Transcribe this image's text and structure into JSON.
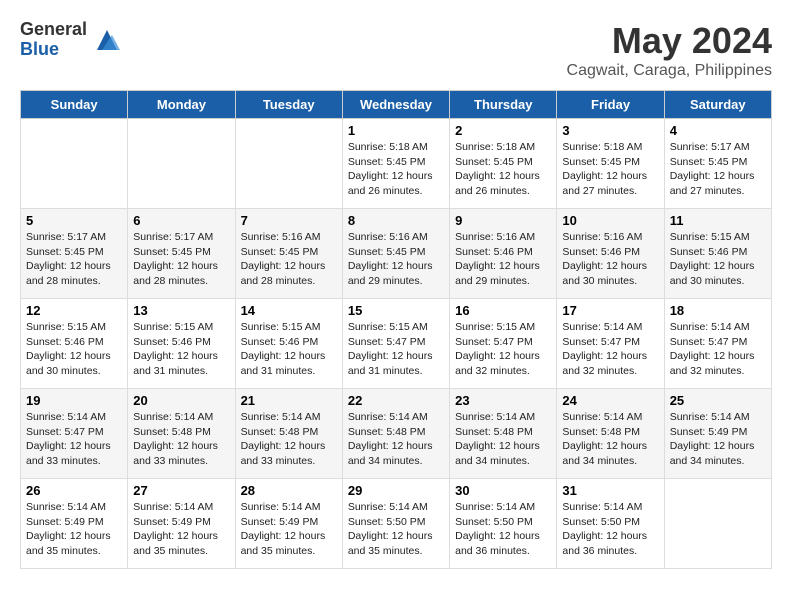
{
  "logo": {
    "general": "General",
    "blue": "Blue"
  },
  "title": "May 2024",
  "subtitle": "Cagwait, Caraga, Philippines",
  "days": [
    "Sunday",
    "Monday",
    "Tuesday",
    "Wednesday",
    "Thursday",
    "Friday",
    "Saturday"
  ],
  "weeks": [
    [
      {
        "date": "",
        "content": ""
      },
      {
        "date": "",
        "content": ""
      },
      {
        "date": "",
        "content": ""
      },
      {
        "date": "1",
        "content": "Sunrise: 5:18 AM\nSunset: 5:45 PM\nDaylight: 12 hours and 26 minutes."
      },
      {
        "date": "2",
        "content": "Sunrise: 5:18 AM\nSunset: 5:45 PM\nDaylight: 12 hours and 26 minutes."
      },
      {
        "date": "3",
        "content": "Sunrise: 5:18 AM\nSunset: 5:45 PM\nDaylight: 12 hours and 27 minutes."
      },
      {
        "date": "4",
        "content": "Sunrise: 5:17 AM\nSunset: 5:45 PM\nDaylight: 12 hours and 27 minutes."
      }
    ],
    [
      {
        "date": "5",
        "content": "Sunrise: 5:17 AM\nSunset: 5:45 PM\nDaylight: 12 hours and 28 minutes."
      },
      {
        "date": "6",
        "content": "Sunrise: 5:17 AM\nSunset: 5:45 PM\nDaylight: 12 hours and 28 minutes."
      },
      {
        "date": "7",
        "content": "Sunrise: 5:16 AM\nSunset: 5:45 PM\nDaylight: 12 hours and 28 minutes."
      },
      {
        "date": "8",
        "content": "Sunrise: 5:16 AM\nSunset: 5:45 PM\nDaylight: 12 hours and 29 minutes."
      },
      {
        "date": "9",
        "content": "Sunrise: 5:16 AM\nSunset: 5:46 PM\nDaylight: 12 hours and 29 minutes."
      },
      {
        "date": "10",
        "content": "Sunrise: 5:16 AM\nSunset: 5:46 PM\nDaylight: 12 hours and 30 minutes."
      },
      {
        "date": "11",
        "content": "Sunrise: 5:15 AM\nSunset: 5:46 PM\nDaylight: 12 hours and 30 minutes."
      }
    ],
    [
      {
        "date": "12",
        "content": "Sunrise: 5:15 AM\nSunset: 5:46 PM\nDaylight: 12 hours and 30 minutes."
      },
      {
        "date": "13",
        "content": "Sunrise: 5:15 AM\nSunset: 5:46 PM\nDaylight: 12 hours and 31 minutes."
      },
      {
        "date": "14",
        "content": "Sunrise: 5:15 AM\nSunset: 5:46 PM\nDaylight: 12 hours and 31 minutes."
      },
      {
        "date": "15",
        "content": "Sunrise: 5:15 AM\nSunset: 5:47 PM\nDaylight: 12 hours and 31 minutes."
      },
      {
        "date": "16",
        "content": "Sunrise: 5:15 AM\nSunset: 5:47 PM\nDaylight: 12 hours and 32 minutes."
      },
      {
        "date": "17",
        "content": "Sunrise: 5:14 AM\nSunset: 5:47 PM\nDaylight: 12 hours and 32 minutes."
      },
      {
        "date": "18",
        "content": "Sunrise: 5:14 AM\nSunset: 5:47 PM\nDaylight: 12 hours and 32 minutes."
      }
    ],
    [
      {
        "date": "19",
        "content": "Sunrise: 5:14 AM\nSunset: 5:47 PM\nDaylight: 12 hours and 33 minutes."
      },
      {
        "date": "20",
        "content": "Sunrise: 5:14 AM\nSunset: 5:48 PM\nDaylight: 12 hours and 33 minutes."
      },
      {
        "date": "21",
        "content": "Sunrise: 5:14 AM\nSunset: 5:48 PM\nDaylight: 12 hours and 33 minutes."
      },
      {
        "date": "22",
        "content": "Sunrise: 5:14 AM\nSunset: 5:48 PM\nDaylight: 12 hours and 34 minutes."
      },
      {
        "date": "23",
        "content": "Sunrise: 5:14 AM\nSunset: 5:48 PM\nDaylight: 12 hours and 34 minutes."
      },
      {
        "date": "24",
        "content": "Sunrise: 5:14 AM\nSunset: 5:48 PM\nDaylight: 12 hours and 34 minutes."
      },
      {
        "date": "25",
        "content": "Sunrise: 5:14 AM\nSunset: 5:49 PM\nDaylight: 12 hours and 34 minutes."
      }
    ],
    [
      {
        "date": "26",
        "content": "Sunrise: 5:14 AM\nSunset: 5:49 PM\nDaylight: 12 hours and 35 minutes."
      },
      {
        "date": "27",
        "content": "Sunrise: 5:14 AM\nSunset: 5:49 PM\nDaylight: 12 hours and 35 minutes."
      },
      {
        "date": "28",
        "content": "Sunrise: 5:14 AM\nSunset: 5:49 PM\nDaylight: 12 hours and 35 minutes."
      },
      {
        "date": "29",
        "content": "Sunrise: 5:14 AM\nSunset: 5:50 PM\nDaylight: 12 hours and 35 minutes."
      },
      {
        "date": "30",
        "content": "Sunrise: 5:14 AM\nSunset: 5:50 PM\nDaylight: 12 hours and 36 minutes."
      },
      {
        "date": "31",
        "content": "Sunrise: 5:14 AM\nSunset: 5:50 PM\nDaylight: 12 hours and 36 minutes."
      },
      {
        "date": "",
        "content": ""
      }
    ]
  ]
}
